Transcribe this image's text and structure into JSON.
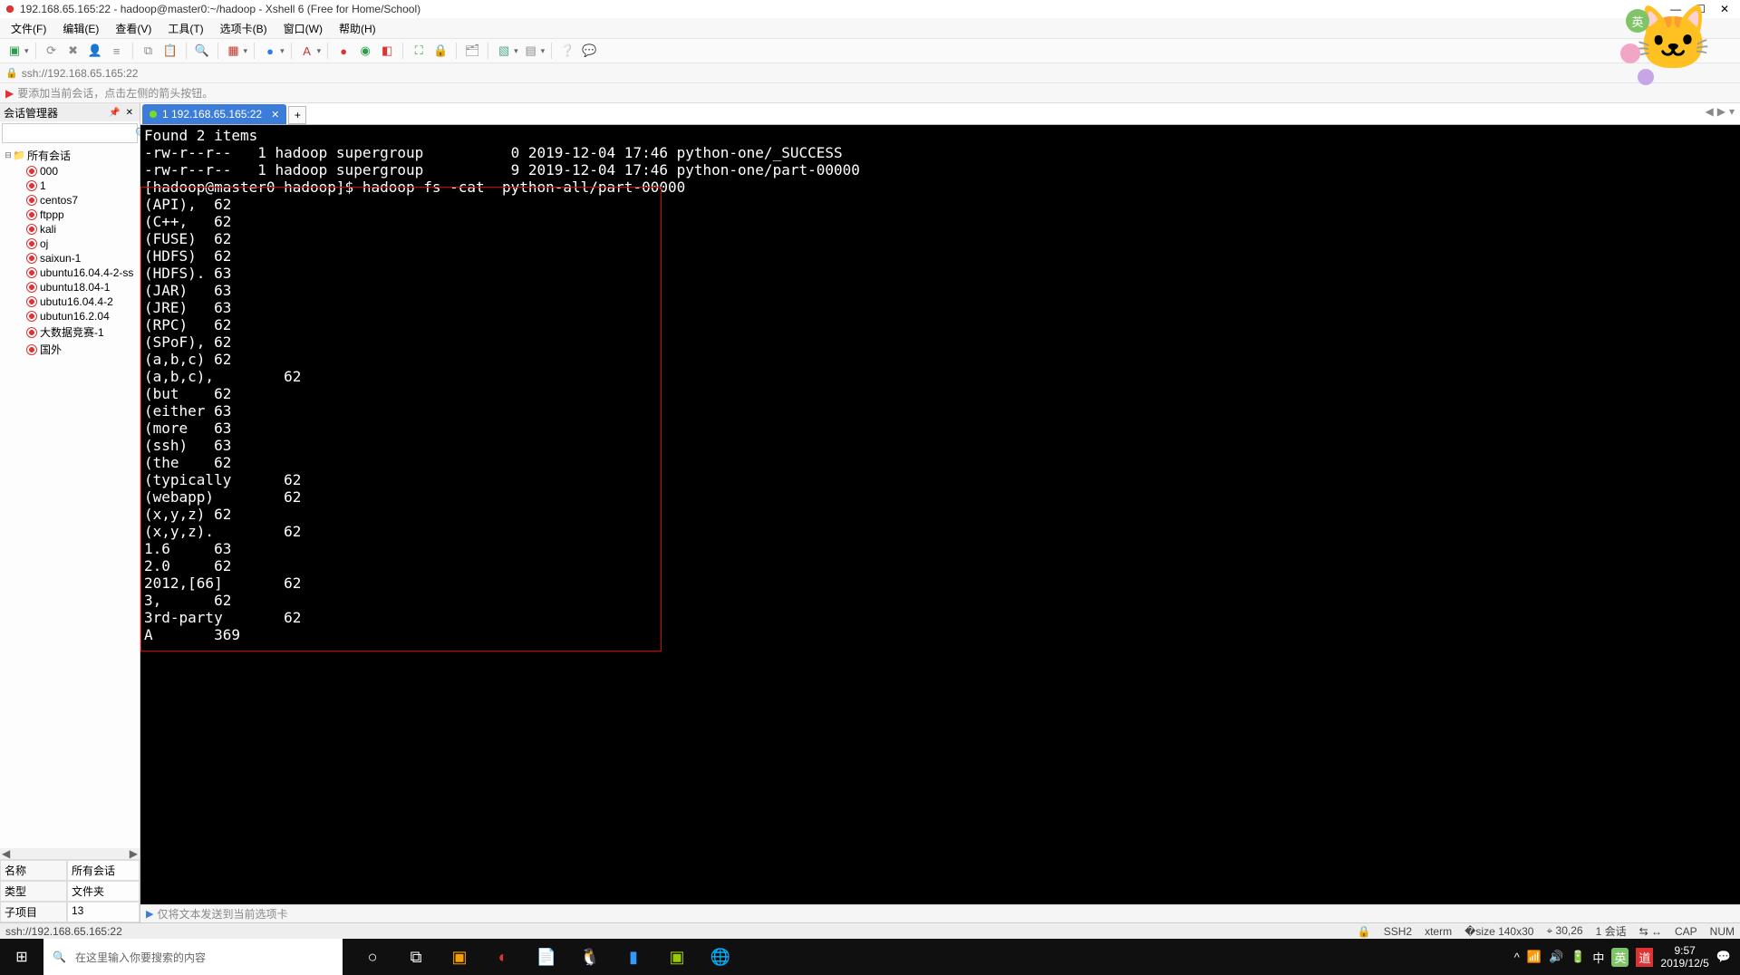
{
  "window": {
    "title": "192.168.65.165:22 - hadoop@master0:~/hadoop - Xshell 6 (Free for Home/School)"
  },
  "menu": {
    "file": "文件(F)",
    "edit": "编辑(E)",
    "view": "查看(V)",
    "tools": "工具(T)",
    "options": "选项卡(B)",
    "window": "窗口(W)",
    "help": "帮助(H)"
  },
  "address": {
    "text": "ssh://192.168.65.165:22"
  },
  "hint": {
    "text": "要添加当前会话，点击左侧的箭头按钮。"
  },
  "session_panel": {
    "title": "会话管理器",
    "root": "所有会话",
    "items": [
      "000",
      "1",
      "centos7",
      "ftppp",
      "kali",
      "oj",
      "saixun-1",
      "ubuntu16.04.4-2-ss",
      "ubuntu18.04-1",
      "ubutu16.04.4-2",
      "ubutun16.2.04",
      "大数据竞赛-1",
      "国外"
    ],
    "prop_name_label": "名称",
    "prop_name_value": "所有会话",
    "prop_type_label": "类型",
    "prop_type_value": "文件夹",
    "prop_sub_label": "子项目",
    "prop_sub_value": "13"
  },
  "tab": {
    "label": "1 192.168.65.165:22"
  },
  "terminal": {
    "lines": [
      "Found 2 items",
      "-rw-r--r--   1 hadoop supergroup          0 2019-12-04 17:46 python-one/_SUCCESS",
      "-rw-r--r--   1 hadoop supergroup          9 2019-12-04 17:46 python-one/part-00000",
      "[hadoop@master0 hadoop]$ hadoop fs -cat  python-all/part-00000",
      "(API),  62",
      "(C++,   62",
      "(FUSE)  62",
      "(HDFS)  62",
      "(HDFS). 63",
      "(JAR)   63",
      "(JRE)   63",
      "(RPC)   62",
      "(SPoF), 62",
      "(a,b,c) 62",
      "(a,b,c),        62",
      "(but    62",
      "(either 63",
      "(more   63",
      "(ssh)   63",
      "(the    62",
      "(typically      62",
      "(webapp)        62",
      "(x,y,z) 62",
      "(x,y,z).        62",
      "1.6     63",
      "2.0     62",
      "2012,[66]       62",
      "3,      62",
      "3rd-party       62",
      "A       369"
    ]
  },
  "bottom_hint": {
    "text": "仅将文本发送到当前选项卡"
  },
  "status": {
    "left": "ssh://192.168.65.165:22",
    "ssh": "SSH2",
    "term": "xterm",
    "size": "140x30",
    "pos": "30,26",
    "sess": "1 会话",
    "link": "⇆ ↔",
    "cap": "CAP",
    "num": "NUM"
  },
  "taskbar": {
    "search_placeholder": "在这里输入你要搜索的内容",
    "time": "9:57",
    "date": "2019/12/5"
  },
  "ime_badge": "英"
}
